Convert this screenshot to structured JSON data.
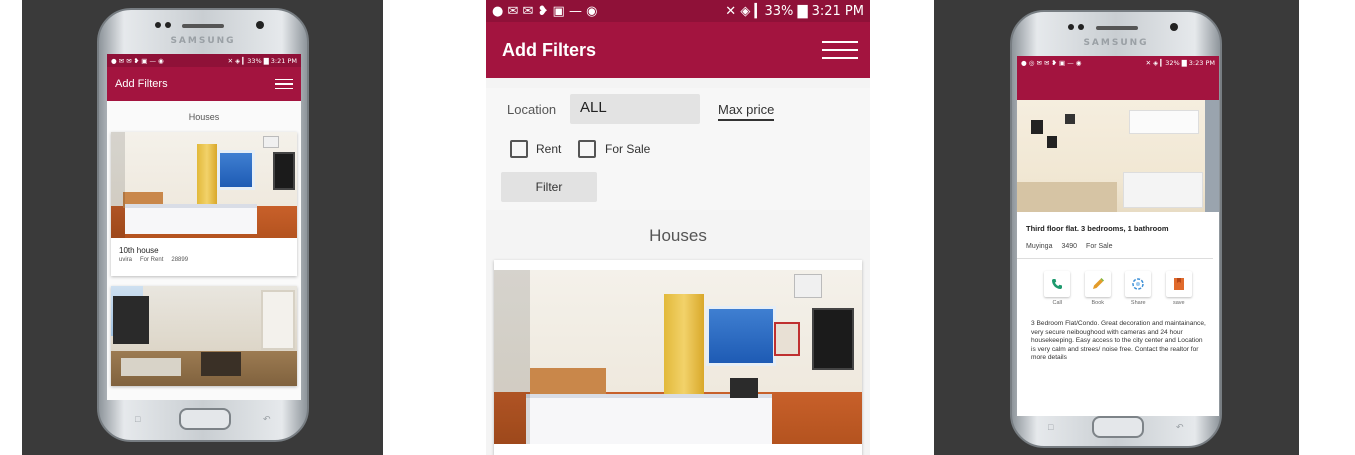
{
  "phone_brand": "SAMSUNG",
  "left_screen": {
    "status": {
      "icons": "● ✉ ✉ ❥ ▣ — ◉",
      "right": "✕ ◈ ▎33% ▇ 3:21 PM"
    },
    "appbar_title": "Add Filters",
    "section_title": "Houses",
    "card1": {
      "title": "10th house",
      "location": "uvira",
      "type": "For Rent",
      "price": "28899"
    }
  },
  "middle_screen": {
    "status": {
      "icons": "● ✉ ✉ ❥ ▣ — ◉",
      "right": "✕ ◈ ▎33% ▇ 3:21 PM"
    },
    "appbar_title": "Add Filters",
    "location_label": "Location",
    "location_value": "ALL",
    "max_price_label": "Max price",
    "rent_label": "Rent",
    "for_sale_label": "For Sale",
    "filter_button": "Filter",
    "section_title": "Houses"
  },
  "right_screen": {
    "status": {
      "icons": "● ◎ ✉ ✉ ❥ ▣ — ◉",
      "right": "✕ ◈ ▎32% ▇ 3:23 PM"
    },
    "listing_title": "Third floor flat. 3 bedrooms, 1 bathroom",
    "location": "Muyinga",
    "price": "3490",
    "type": "For Sale",
    "actions": [
      {
        "label": "Call",
        "icon": "phone-icon",
        "color": "#1e9a6e"
      },
      {
        "label": "Book",
        "icon": "pencil-icon",
        "color": "#e39b2a"
      },
      {
        "label": "Share",
        "icon": "share-icon",
        "color": "#3c8fd6"
      },
      {
        "label": "save",
        "icon": "bookmark-icon",
        "color": "#e06a2c"
      }
    ],
    "description": "3 Bedroom Flat/Condo. Great decoration and maintainance, very secure neiboughood with cameras and 24 hour housekeeping. Easy access to the city center and Location is very calm and strees/ noise free. Contact the realtor for more details"
  },
  "colors": {
    "appbar": "#a3143f",
    "statusbar": "#8f1138"
  }
}
